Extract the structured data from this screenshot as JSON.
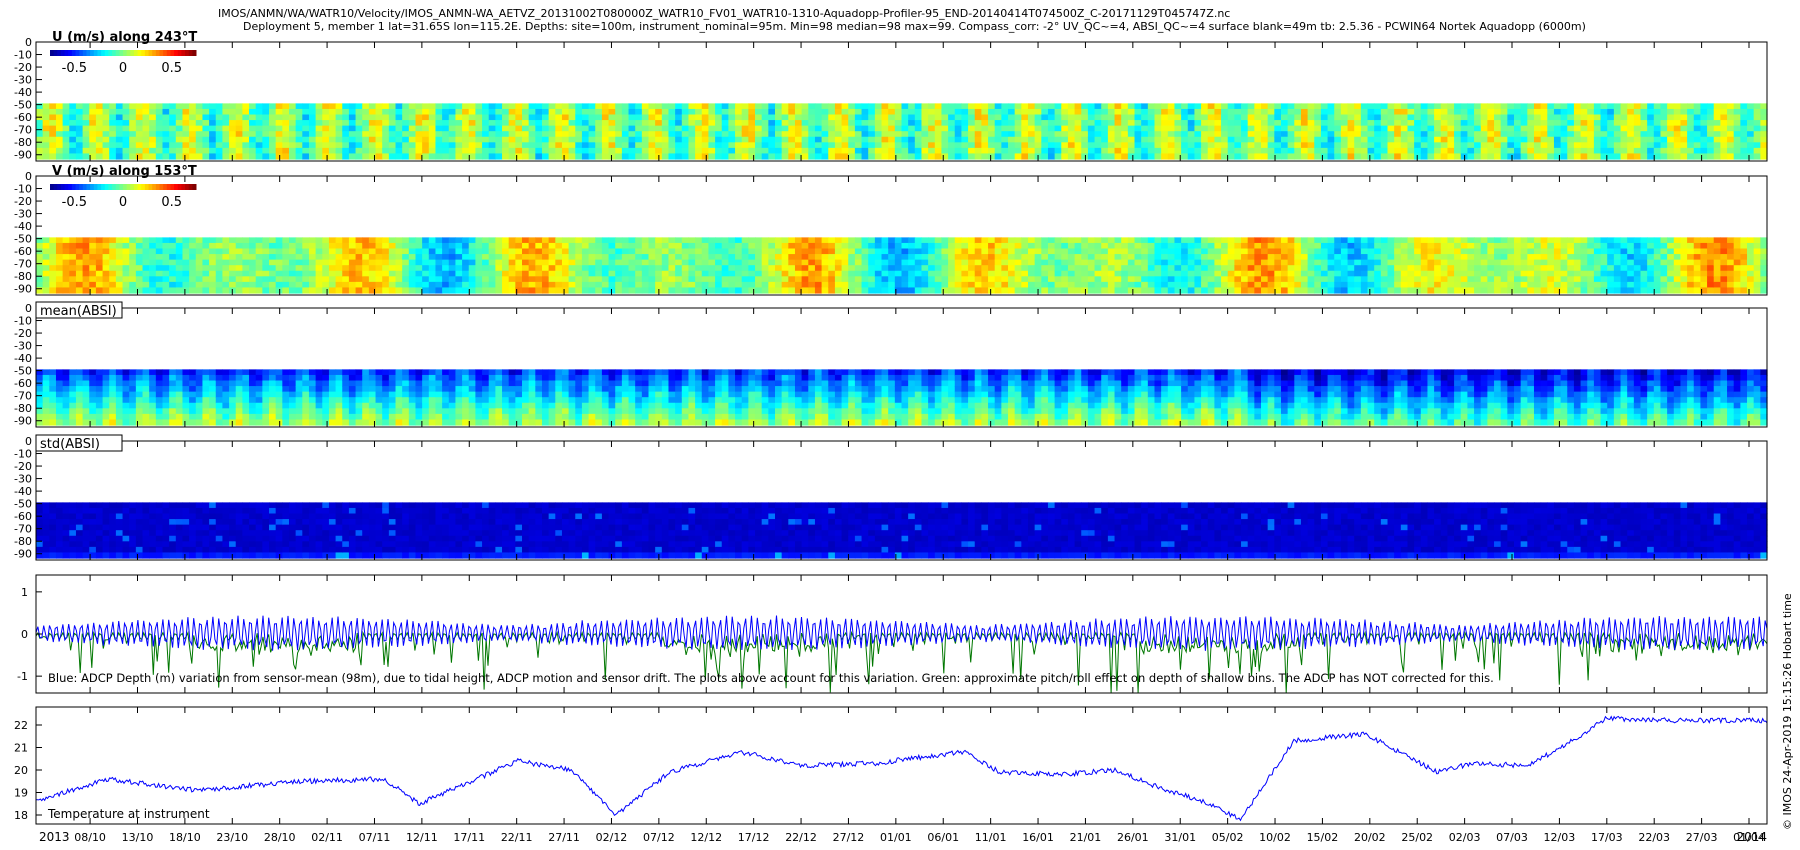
{
  "header": {
    "line1": "IMOS/ANMN/WA/WATR10/Velocity/IMOS_ANMN-WA_AETVZ_20131002T080000Z_WATR10_FV01_WATR10-1310-Aquadopp-Profiler-95_END-20140414T074500Z_C-20171129T045747Z.nc",
    "line2": "Deployment 5, member 1 lat=31.65S lon=115.2E. Depths: site=100m, instrument_nominal=95m. Min=98 median=98 max=99. Compass_corr: -2° UV_QC~=4, ABSI_QC~=4 surface blank=49m tb: 2.5.36 - PCWIN64 Nortek Aquadopp  (6000m)"
  },
  "side_stamp": "© IMOS 24-Apr-2019 15:15:26 Hobart time",
  "colors": {
    "depth_line": "#0000ff",
    "pitch_roll_line": "#007700",
    "temperature_line": "#0000ff",
    "colormap": [
      "#00008f",
      "#0000ff",
      "#0080ff",
      "#00ffff",
      "#80ff80",
      "#ffff00",
      "#ff8000",
      "#ff0000",
      "#800000"
    ]
  },
  "chart_data": [
    {
      "type": "heatmap",
      "label": "U (m/s) along 243°T",
      "colorbar": {
        "ticks": [
          "-0.5",
          "0",
          "0.5"
        ],
        "range": [
          -0.75,
          0.75
        ]
      },
      "y_ticks": [
        "0",
        "-10",
        "-20",
        "-30",
        "-40",
        "-50",
        "-60",
        "-70",
        "-80",
        "-90"
      ],
      "ylim": [
        -95,
        0
      ],
      "data_depth_range": [
        -93,
        -49
      ],
      "typical_value_range": [
        -0.3,
        0.3
      ]
    },
    {
      "type": "heatmap",
      "label": "V (m/s) along 153°T",
      "colorbar": {
        "ticks": [
          "-0.5",
          "0",
          "0.5"
        ],
        "range": [
          -0.75,
          0.75
        ]
      },
      "y_ticks": [
        "0",
        "-10",
        "-20",
        "-30",
        "-40",
        "-50",
        "-60",
        "-70",
        "-80",
        "-90"
      ],
      "ylim": [
        -95,
        0
      ],
      "data_depth_range": [
        -93,
        -49
      ],
      "typical_value_range": [
        -0.5,
        0.6
      ]
    },
    {
      "type": "heatmap",
      "label": "mean(ABSI)",
      "y_ticks": [
        "0",
        "-10",
        "-20",
        "-30",
        "-40",
        "-50",
        "-60",
        "-70",
        "-80",
        "-90"
      ],
      "ylim": [
        -95,
        0
      ],
      "data_depth_range": [
        -93,
        -49
      ]
    },
    {
      "type": "heatmap",
      "label": "std(ABSI)",
      "y_ticks": [
        "0",
        "-10",
        "-20",
        "-30",
        "-40",
        "-50",
        "-60",
        "-70",
        "-80",
        "-90"
      ],
      "ylim": [
        -95,
        0
      ],
      "data_depth_range": [
        -93,
        -49
      ]
    },
    {
      "type": "line",
      "annotation": "Blue: ADCP Depth (m) variation from sensor-mean (98m), due to tidal height, ADCP motion and sensor drift. The plots above account for this variation. Green: approximate pitch/roll effect on depth of shallow bins. The ADCP has NOT corrected for this.",
      "y_ticks": [
        "1",
        "0",
        "-1"
      ],
      "ylim": [
        -1.4,
        1.4
      ],
      "depth_variation_range": [
        -0.55,
        0.55
      ],
      "pitch_roll_range": [
        -1.4,
        0
      ]
    },
    {
      "type": "line",
      "annotation": "Temperature at instrument",
      "y_ticks": [
        "22",
        "21",
        "20",
        "19",
        "18"
      ],
      "ylim": [
        17.6,
        22.8
      ],
      "x": [
        "2013-10-02",
        "2013-10-10",
        "2013-10-20",
        "2013-11-01",
        "2013-11-10",
        "2013-11-14",
        "2013-11-25",
        "2013-12-01",
        "2013-12-06",
        "2013-12-12",
        "2013-12-20",
        "2013-12-27",
        "2014-01-04",
        "2014-01-14",
        "2014-01-18",
        "2014-01-25",
        "2014-01-31",
        "2014-02-05",
        "2014-02-10",
        "2014-02-14",
        "2014-02-20",
        "2014-02-28",
        "2014-03-08",
        "2014-03-12",
        "2014-03-18",
        "2014-03-22",
        "2014-03-27",
        "2014-04-03",
        "2014-04-14"
      ],
      "y": [
        18.6,
        19.6,
        19.1,
        19.5,
        19.6,
        18.5,
        20.4,
        20.0,
        18.0,
        19.9,
        20.8,
        20.2,
        20.3,
        20.8,
        19.9,
        19.8,
        20.0,
        19.2,
        18.6,
        17.8,
        21.3,
        21.6,
        19.9,
        20.3,
        20.2,
        21.0,
        22.3,
        22.2,
        22.2
      ]
    }
  ],
  "x_axis": {
    "year_start": "2013",
    "year_end": "2014",
    "tick_labels": [
      "08/10",
      "13/10",
      "18/10",
      "23/10",
      "28/10",
      "02/11",
      "07/11",
      "12/11",
      "17/11",
      "22/11",
      "27/11",
      "02/12",
      "07/12",
      "12/12",
      "17/12",
      "22/12",
      "27/12",
      "01/01",
      "06/01",
      "11/01",
      "16/01",
      "21/01",
      "26/01",
      "31/01",
      "05/02",
      "10/02",
      "15/02",
      "20/02",
      "25/02",
      "02/03",
      "07/03",
      "12/03",
      "17/03",
      "22/03",
      "27/03",
      "01/04"
    ]
  }
}
